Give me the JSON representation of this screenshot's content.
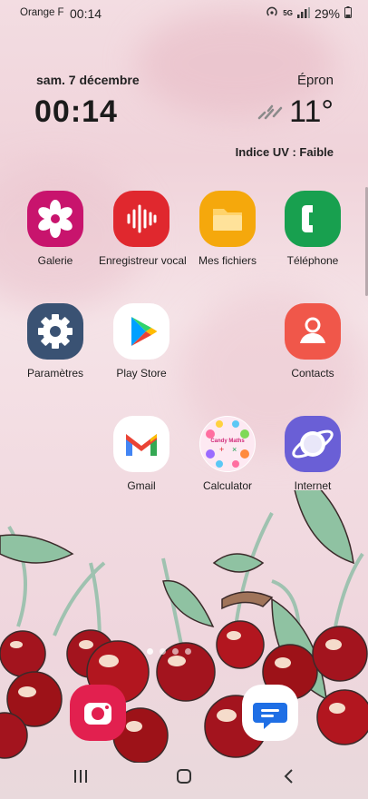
{
  "status": {
    "carrier": "Orange F",
    "time": "00:14",
    "network": "5G",
    "battery": "29%"
  },
  "widget": {
    "date": "sam. 7 décembre",
    "time": "00:14",
    "city": "Épron",
    "temperature": "11°",
    "uv": "Indice UV : Faible"
  },
  "apps": [
    {
      "label": "Galerie",
      "icon": "gallery-icon"
    },
    {
      "label": "Enregistreur vocal",
      "icon": "voice-recorder-icon"
    },
    {
      "label": "Mes fichiers",
      "icon": "files-icon"
    },
    {
      "label": "Téléphone",
      "icon": "phone-icon"
    },
    {
      "label": "Paramètres",
      "icon": "settings-icon"
    },
    {
      "label": "Play Store",
      "icon": "play-store-icon"
    },
    {
      "label": "Contacts",
      "icon": "contacts-icon"
    },
    {
      "label": "Gmail",
      "icon": "gmail-icon"
    },
    {
      "label": "Calculator",
      "icon": "calculator-icon"
    },
    {
      "label": "Internet",
      "icon": "internet-icon"
    }
  ],
  "calculator_icon_text": "Candy Maths",
  "dock": [
    {
      "icon": "camera-icon"
    },
    {
      "icon": "messages-icon"
    }
  ],
  "colors": {
    "gallery": "#c8146d",
    "recorder": "#e0282e",
    "files": "#f5a80c",
    "phone": "#18a04f",
    "settings": "#3a5273",
    "contacts": "#f0574a",
    "internet": "#6a5fd6",
    "camera": "#e2204f",
    "messages": "#1f6fe5"
  }
}
